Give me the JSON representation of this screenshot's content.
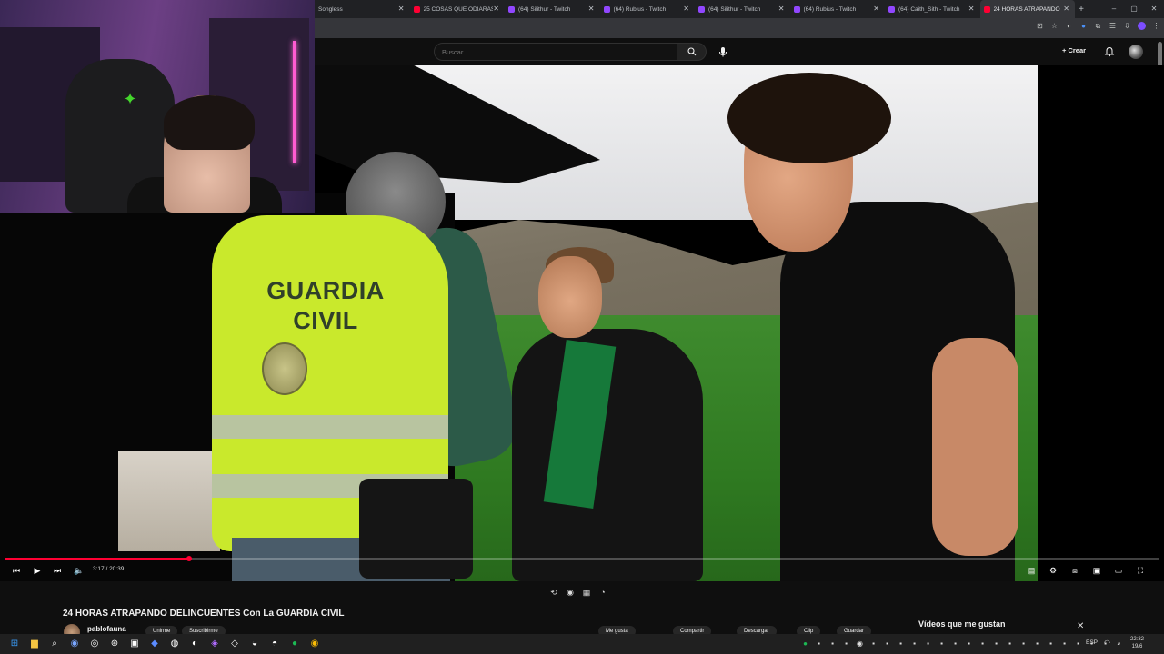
{
  "browser": {
    "tabs": [
      {
        "label": "Songless",
        "fav": "sg",
        "active": false
      },
      {
        "label": "25 COSAS QUE ODIARÁS",
        "fav": "yt",
        "active": false
      },
      {
        "label": "(64) Silithur - Twitch",
        "fav": "tw",
        "active": false
      },
      {
        "label": "(64) Rubius - Twitch",
        "fav": "tw",
        "active": false
      },
      {
        "label": "(64) Silithur - Twitch",
        "fav": "tw",
        "active": false
      },
      {
        "label": "(64) Rubius - Twitch",
        "fav": "tw",
        "active": false
      },
      {
        "label": "(64) Caith_Sith - Twitch",
        "fav": "tw",
        "active": false
      },
      {
        "label": "24 HORAS ATRAPANDO",
        "fav": "yt",
        "active": true
      }
    ],
    "new_tab": "+",
    "controls": {
      "minimize": "–",
      "maximize": "▢",
      "close": "✕"
    }
  },
  "youtube": {
    "search_placeholder": "Buscar",
    "create_label": "Crear",
    "icons": [
      "search-icon",
      "mic-icon",
      "bell-icon",
      "avatar"
    ]
  },
  "video": {
    "vest_line1": "GUARDIA",
    "vest_line2": "CIVIL",
    "current_time": "3:17",
    "duration": "20:39",
    "progress_fraction": 0.159,
    "time_display": "3:17 / 20:39",
    "title": "24 HORAS ATRAPANDO DELINCUENTES Con La GUARDIA CIVIL",
    "channel": "pablofauna",
    "subscribe_label": "Unirme",
    "subscribed_label": "Suscribirme",
    "actions": [
      "Me gusta",
      "Compartir",
      "Descargar",
      "Clip",
      "Guardar"
    ]
  },
  "sidebar": {
    "liked_title": "Vídeos que me gustan",
    "close": "✕"
  },
  "taskbar": {
    "lang": "ESP",
    "time": "22:32",
    "date": "19/6"
  },
  "colors": {
    "youtube_red": "#ff0033",
    "twitch_purple": "#9147ff",
    "vest_yellow": "#c9e92c"
  }
}
